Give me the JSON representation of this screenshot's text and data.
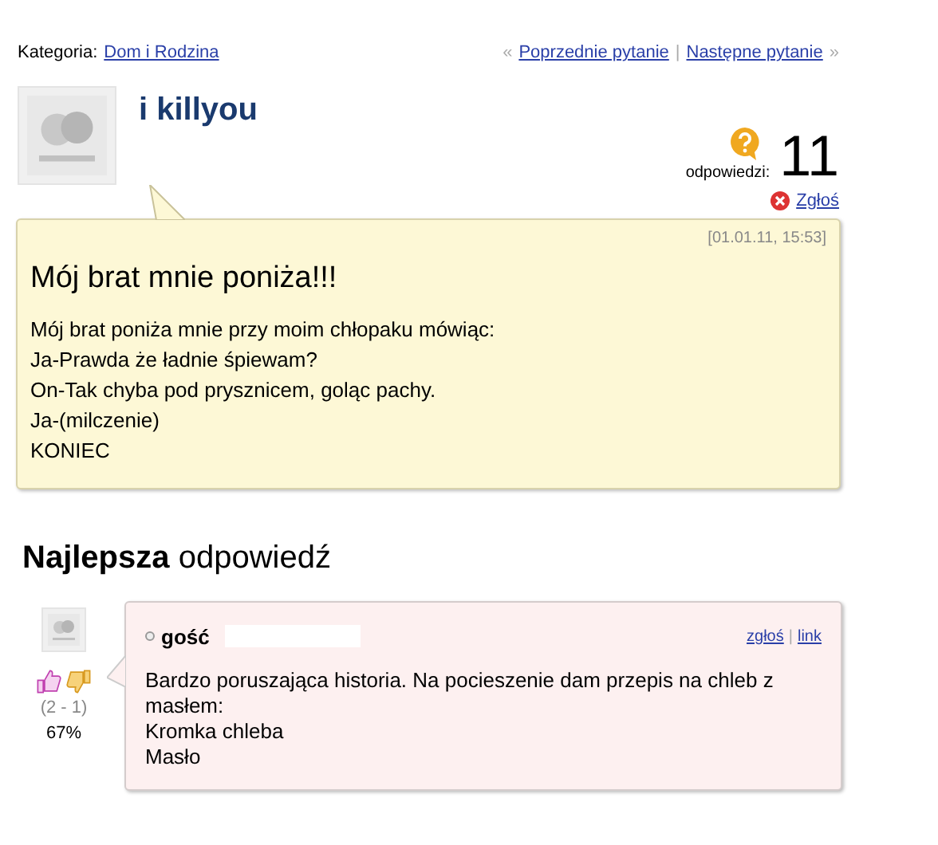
{
  "breadcrumb": {
    "label": "Kategoria:",
    "category": "Dom i Rodzina"
  },
  "nav": {
    "prev_mark": "«",
    "prev": "Poprzednie pytanie",
    "separator": "|",
    "next": "Następne pytanie",
    "next_mark": "»"
  },
  "question": {
    "author": "i killyou",
    "answers_label": "odpowiedzi:",
    "answers_count": "11",
    "report": "Zgłoś",
    "date": "[01.01.11, 15:53]",
    "title": "Mój brat mnie poniża!!!",
    "body": [
      "Mój brat poniża mnie przy moim chłopaku mówiąc:",
      "Ja-Prawda że ładnie śpiewam?",
      "On-Tak chyba pod prysznicem, goląc pachy.",
      "Ja-(milczenie)",
      "KONIEC"
    ]
  },
  "best_answer": {
    "heading_bold": "Najlepsza",
    "heading_rest": "odpowiedź",
    "author": "gość",
    "report": "zgłoś",
    "separator": "|",
    "link": "link",
    "votes": "(2 - 1)",
    "percent": "67%",
    "body": [
      "Bardzo poruszająca historia. Na pocieszenie dam przepis na chleb z masłem:",
      "Kromka chleba",
      "Masło"
    ]
  }
}
